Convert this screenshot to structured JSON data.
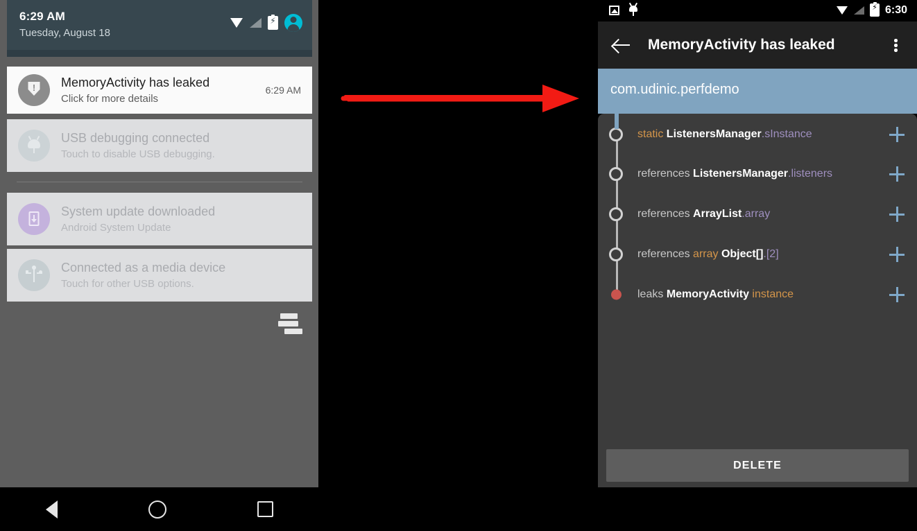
{
  "left_phone": {
    "status_bar": {
      "time": "6:29 AM",
      "date": "Tuesday, August 18",
      "icons": [
        "wifi-icon",
        "signal-icon",
        "battery-charging-icon",
        "user-avatar-icon"
      ]
    },
    "notifications": [
      {
        "icon": "shield-alert-icon",
        "title": "MemoryActivity has leaked",
        "subtitle": "Click for more details",
        "time": "6:29 AM",
        "state": "active"
      },
      {
        "icon": "android-bug-icon",
        "title": "USB debugging connected",
        "subtitle": "Touch to disable USB debugging.",
        "time": "",
        "state": "dim"
      },
      {
        "icon": "download-icon",
        "title": "System update downloaded",
        "subtitle": "Android System Update",
        "time": "",
        "state": "dim"
      },
      {
        "icon": "usb-icon",
        "title": "Connected as a media device",
        "subtitle": "Touch for other USB options.",
        "time": "",
        "state": "dim"
      }
    ],
    "clear_all_icon": "clear-all-notifications-icon",
    "nav_bar": [
      "back-icon",
      "home-icon",
      "recents-icon"
    ]
  },
  "annotation": {
    "arrow_icon": "red-arrow-right",
    "color": "#f21b14"
  },
  "right_phone": {
    "status_bar": {
      "time": "6:30",
      "left_icons": [
        "screenshot-icon",
        "android-debug-icon"
      ],
      "right_icons": [
        "wifi-icon",
        "signal-icon",
        "battery-charging-icon"
      ]
    },
    "app_bar": {
      "back_icon": "arrow-back-icon",
      "title": "MemoryActivity has leaked",
      "overflow_icon": "more-vert-icon"
    },
    "package_name": "com.udinic.perfdemo",
    "package_band_color": "#80a4c0",
    "leak_trace": [
      {
        "node": "hollow",
        "relation": "static",
        "relation_style": "keyword",
        "class_name": "ListenersManager",
        "separator": ".",
        "field": "sInstance",
        "expand_icon": "plus-icon"
      },
      {
        "node": "hollow",
        "relation": "references",
        "relation_style": "plain",
        "class_name": "ListenersManager",
        "separator": ".",
        "field": "listeners",
        "expand_icon": "plus-icon"
      },
      {
        "node": "hollow",
        "relation": "references",
        "relation_style": "plain",
        "class_name": "ArrayList",
        "separator": ".",
        "field": "array",
        "expand_icon": "plus-icon"
      },
      {
        "node": "hollow",
        "relation": "references",
        "relation_style": "plain",
        "keyword": "array",
        "class_name": "Object[]",
        "separator": ".",
        "field": "[2]",
        "expand_icon": "plus-icon"
      },
      {
        "node": "leak",
        "relation": "leaks",
        "relation_style": "plain",
        "class_name": "MemoryActivity",
        "separator": " ",
        "field": "instance",
        "field_style": "keyword",
        "expand_icon": "plus-icon"
      }
    ],
    "delete_label": "DELETE",
    "nav_bar": [
      "back-icon",
      "home-icon",
      "recents-icon"
    ]
  }
}
